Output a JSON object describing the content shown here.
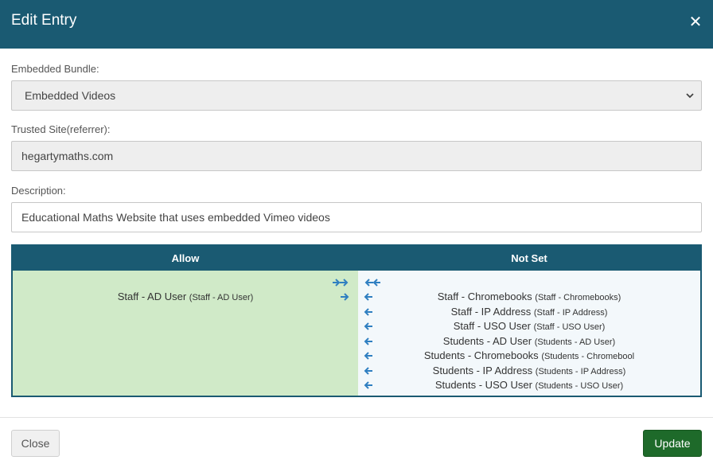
{
  "dialog": {
    "title": "Edit Entry",
    "close_icon": "close-icon"
  },
  "form": {
    "bundle_label": "Embedded Bundle:",
    "bundle_value": "Embedded Videos",
    "site_label": "Trusted Site(referrer):",
    "site_value": "hegartymaths.com",
    "description_label": "Description:",
    "description_value": "Educational Maths Website that uses embedded Vimeo videos"
  },
  "table": {
    "allow_header": "Allow",
    "notset_header": "Not Set",
    "allow_items": [
      {
        "name": "Staff - AD User",
        "sub": "(Staff - AD User)"
      }
    ],
    "notset_items": [
      {
        "name": "Staff - Chromebooks",
        "sub": "(Staff - Chromebooks)"
      },
      {
        "name": "Staff - IP Address",
        "sub": "(Staff - IP Address)"
      },
      {
        "name": "Staff - USO User",
        "sub": "(Staff - USO User)"
      },
      {
        "name": "Students - AD User",
        "sub": "(Students - AD User)"
      },
      {
        "name": "Students - Chromebooks",
        "sub": "(Students - Chromebool"
      },
      {
        "name": "Students - IP Address",
        "sub": "(Students - IP Address)"
      },
      {
        "name": "Students - USO User",
        "sub": "(Students - USO User)"
      }
    ]
  },
  "footer": {
    "close_label": "Close",
    "update_label": "Update"
  },
  "colors": {
    "header": "#1a5a72",
    "allow_bg": "#d0eac8",
    "notset_bg": "#f3f8fb",
    "arrow": "#2f7fc1",
    "update": "#1e6a2a"
  }
}
